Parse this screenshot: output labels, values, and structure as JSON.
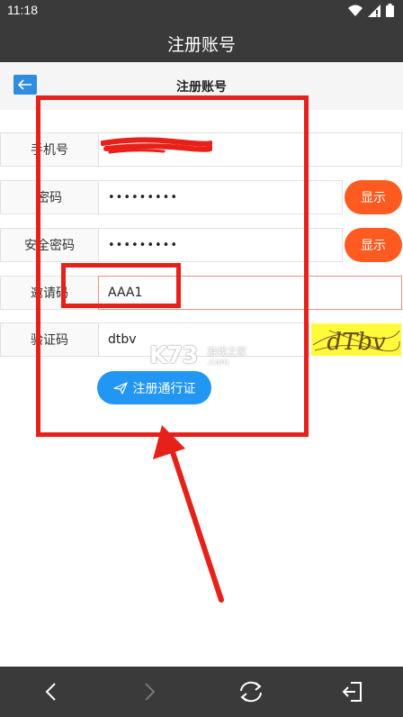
{
  "status_bar": {
    "time": "11:18"
  },
  "app_bar": {
    "title": "注册账号"
  },
  "page_header": {
    "title": "注册账号"
  },
  "form": {
    "phone": {
      "label": "手机号",
      "value": ""
    },
    "password": {
      "label": "密码",
      "value": "•••••••••",
      "show_label": "显示"
    },
    "safe_password": {
      "label": "安全密码",
      "value": "•••••••••",
      "show_label": "显示"
    },
    "invite_code": {
      "label": "邀请码",
      "value": "AAA1"
    },
    "captcha": {
      "label": "验证码",
      "value": "dtbv",
      "image_text": "dTbv"
    }
  },
  "submit": {
    "label": "注册通行证"
  },
  "watermark": {
    "main": "K73",
    "sub": "游戏之家",
    "url": ".com"
  },
  "colors": {
    "bar_bg": "#3a3a3a",
    "show_button": "#ff5a1f",
    "submit_button": "#2196f3",
    "annotation": "#e8201a",
    "captcha_bg": "#fffb3a"
  }
}
